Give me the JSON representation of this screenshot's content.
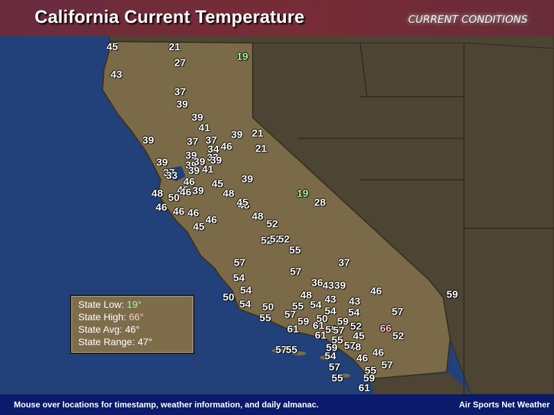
{
  "header": {
    "title": "California Current Temperature",
    "badge": "CURRENT CONDITIONS"
  },
  "stats": {
    "low_label": "State Low:",
    "low_value": "19°",
    "high_label": "State High:",
    "high_value": "66°",
    "avg_label": "State Avg:",
    "avg_value": "46°",
    "range_label": "State Range:",
    "range_value": "47°"
  },
  "footer": {
    "left": "Mouse over locations for timestamp, weather information, and daily almanac.",
    "right": "Air Sports Net Weather"
  },
  "colors": {
    "ocean": "#22417a",
    "land_california": "#7a6a47",
    "land_other": "#4d4433",
    "header": "#7a2b37",
    "footer": "#0b1a6a",
    "low_text": "#a9f5a0",
    "high_text": "#ffc9c9"
  },
  "temperatures": [
    "45",
    "21",
    "19",
    "27",
    "43",
    "37",
    "39",
    "39",
    "41",
    "39",
    "21",
    "39",
    "37",
    "37",
    "46",
    "21",
    "34",
    "39",
    "33",
    "39",
    "39",
    "37",
    "39",
    "39",
    "41",
    "39",
    "33",
    "46",
    "45",
    "39",
    "48",
    "45",
    "50",
    "46",
    "39",
    "46",
    "46",
    "48",
    "48",
    "19",
    "28",
    "46",
    "45",
    "48",
    "52",
    "46",
    "45",
    "52",
    "52",
    "52",
    "55",
    "57",
    "57",
    "37",
    "54",
    "36",
    "43",
    "39",
    "54",
    "46",
    "48",
    "50",
    "54",
    "55",
    "54",
    "43",
    "50",
    "43",
    "55",
    "57",
    "59",
    "54",
    "61",
    "54",
    "50",
    "61",
    "55",
    "59",
    "52",
    "57",
    "57",
    "52",
    "61",
    "45",
    "66",
    "52",
    "55",
    "57",
    "55",
    "59",
    "48",
    "54",
    "57",
    "46",
    "46",
    "57",
    "57",
    "55",
    "59",
    "55",
    "61",
    "59"
  ]
}
